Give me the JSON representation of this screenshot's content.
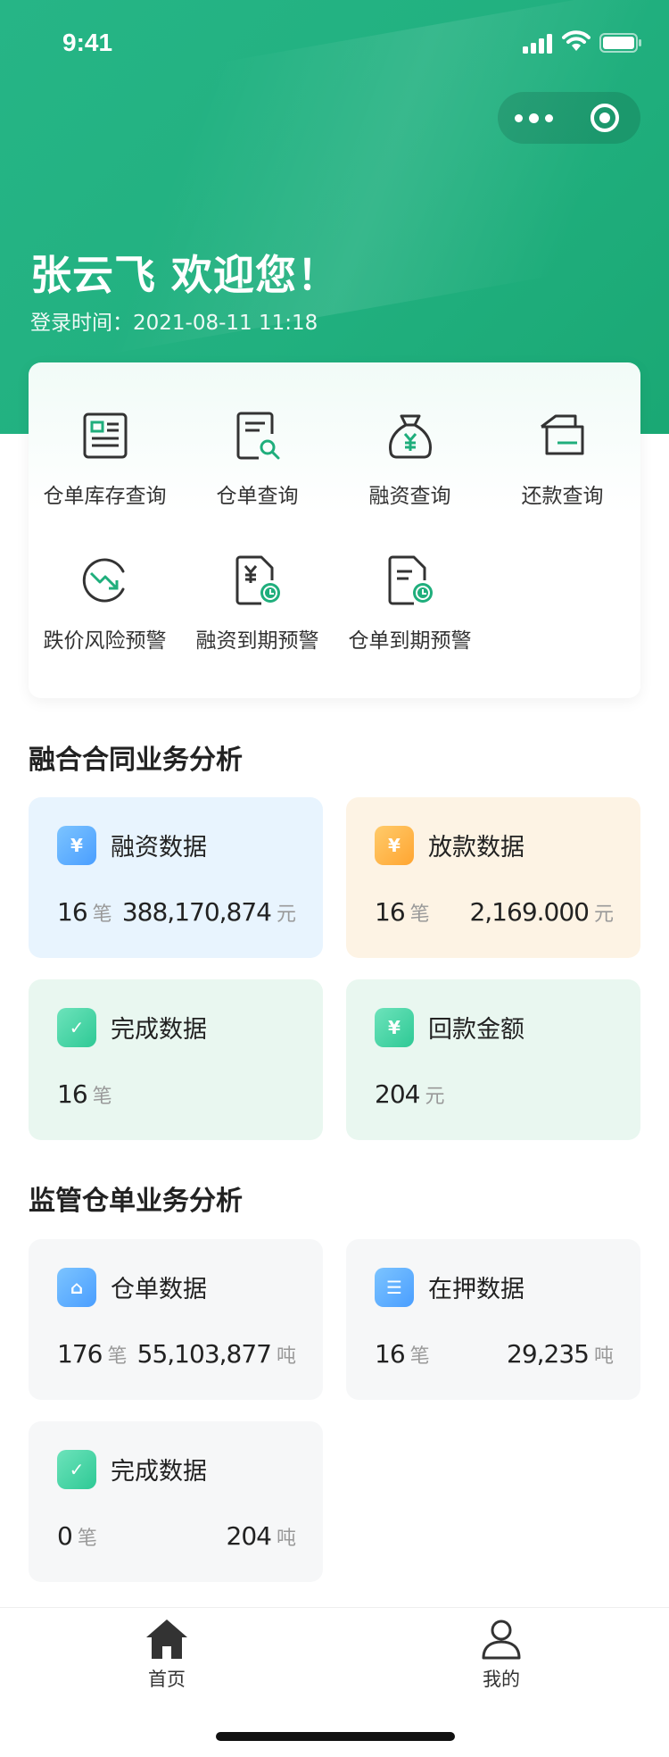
{
  "status_bar": {
    "time": "9:41"
  },
  "capsule": {
    "more_icon": "more-dots-icon",
    "close_icon": "target-close-icon"
  },
  "header": {
    "welcome": "张云飞 欢迎您！",
    "login_time": "登录时间：2021-08-11 11:18"
  },
  "menu": {
    "items": [
      {
        "label": "仓单库存查询",
        "icon": "document-list-icon"
      },
      {
        "label": "仓单查询",
        "icon": "document-search-icon"
      },
      {
        "label": "融资查询",
        "icon": "money-bag-icon"
      },
      {
        "label": "还款查询",
        "icon": "payment-card-icon"
      },
      {
        "label": "跌价风险预警",
        "icon": "price-drop-icon"
      },
      {
        "label": "融资到期预警",
        "icon": "finance-due-icon"
      },
      {
        "label": "仓单到期预警",
        "icon": "receipt-due-icon"
      }
    ]
  },
  "section1": {
    "title": "融合合同业务分析",
    "cards": [
      {
        "title": "融资数据",
        "count": "16",
        "count_unit": "笔",
        "amount": "388,170,874",
        "amount_unit": "元",
        "icon": "finance-data-icon",
        "color": "#5aaeff"
      },
      {
        "title": "放款数据",
        "count": "16",
        "count_unit": "笔",
        "amount": "2,169.000",
        "amount_unit": "元",
        "icon": "loan-data-icon",
        "color": "#ffb648"
      },
      {
        "title": "完成数据",
        "count": "16",
        "count_unit": "笔",
        "icon": "complete-check-icon",
        "color": "#44d3a4"
      },
      {
        "title": "回款金额",
        "count": "204",
        "count_unit": "元",
        "icon": "repayment-icon",
        "color": "#44d3a4"
      }
    ]
  },
  "section2": {
    "title": "监管仓单业务分析",
    "cards": [
      {
        "title": "仓单数据",
        "count": "176",
        "count_unit": "笔",
        "amount": "55,103,877",
        "amount_unit": "吨",
        "icon": "warehouse-icon",
        "color": "#5aaeff"
      },
      {
        "title": "在押数据",
        "count": "16",
        "count_unit": "笔",
        "amount": "29,235",
        "amount_unit": "吨",
        "icon": "storage-box-icon",
        "color": "#5aaeff"
      },
      {
        "title": "完成数据",
        "count": "0",
        "count_unit": "笔",
        "amount": "204",
        "amount_unit": "吨",
        "icon": "complete-check-icon",
        "color": "#44d3a4"
      }
    ]
  },
  "tabbar": {
    "items": [
      {
        "label": "首页",
        "icon": "home-icon"
      },
      {
        "label": "我的",
        "icon": "user-icon"
      }
    ]
  },
  "colors": {
    "primary": "#21b07f",
    "card_blue_bg": "#e8f4fe",
    "card_orange_bg": "#fdf3e4",
    "card_green_bg": "#e9f7f0",
    "card_gray_bg": "#f6f7f8"
  }
}
